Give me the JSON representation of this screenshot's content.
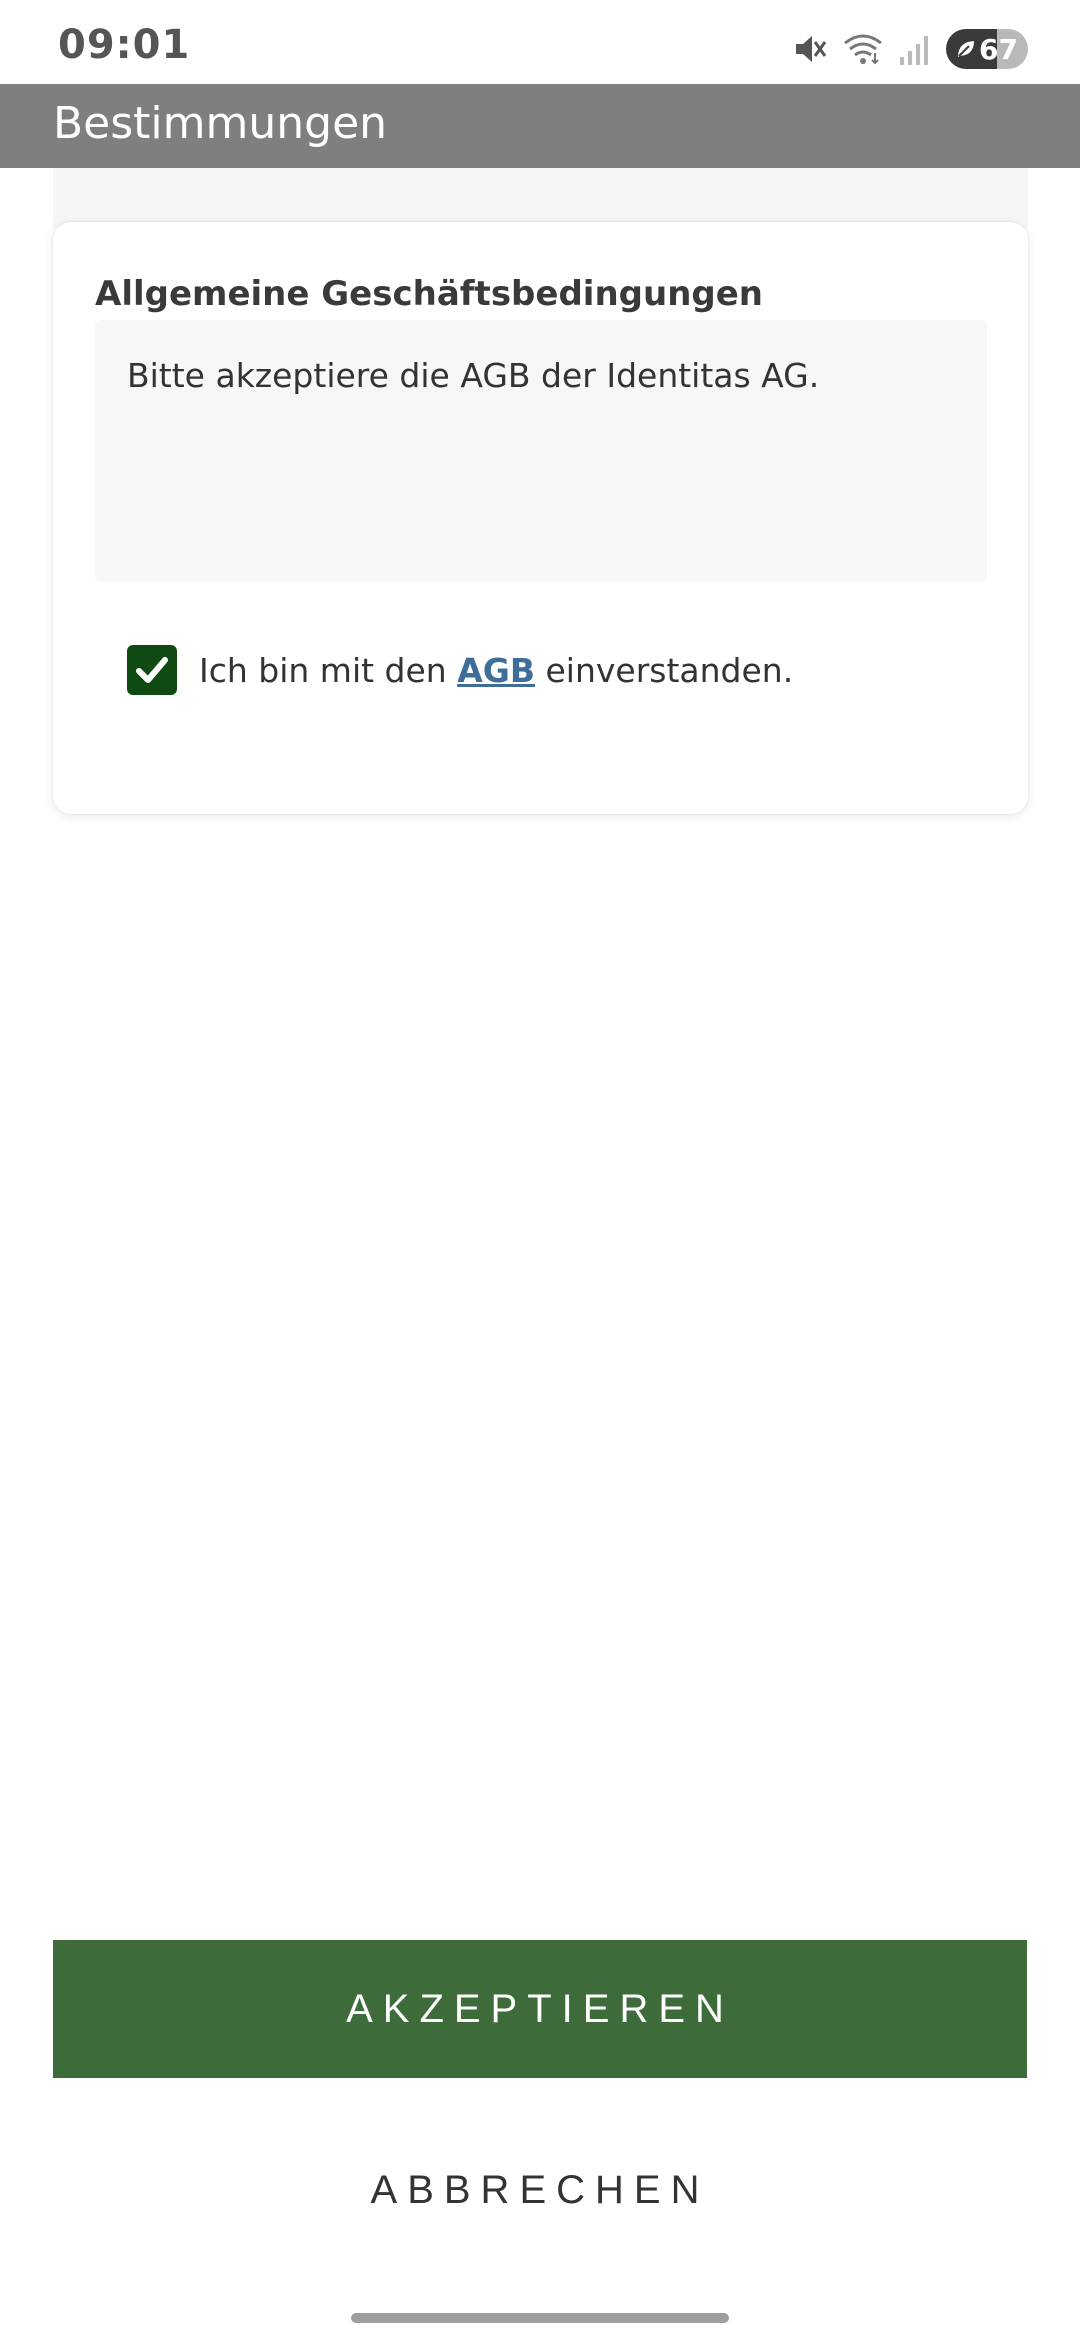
{
  "status_bar": {
    "time": "09:01",
    "battery_level": "67",
    "icons": [
      "mute-icon",
      "wifi-icon",
      "signal-icon",
      "battery-icon"
    ]
  },
  "app_bar": {
    "title": "Bestimmungen"
  },
  "terms_card": {
    "title": "Allgemeine Geschäftsbedingungen",
    "description": "Bitte akzeptiere die AGB der Identitas AG.",
    "consent": {
      "checked": true,
      "text_before": "Ich bin mit den ",
      "link_label": "AGB",
      "text_after": " einverstanden."
    }
  },
  "actions": {
    "accept_label": "AKZEPTIEREN",
    "cancel_label": "ABBRECHEN"
  },
  "colors": {
    "app_bar": "#7f7f7f",
    "accept_button": "#3d6b39",
    "checkbox": "#0f4a12",
    "link": "#3d6d99"
  }
}
